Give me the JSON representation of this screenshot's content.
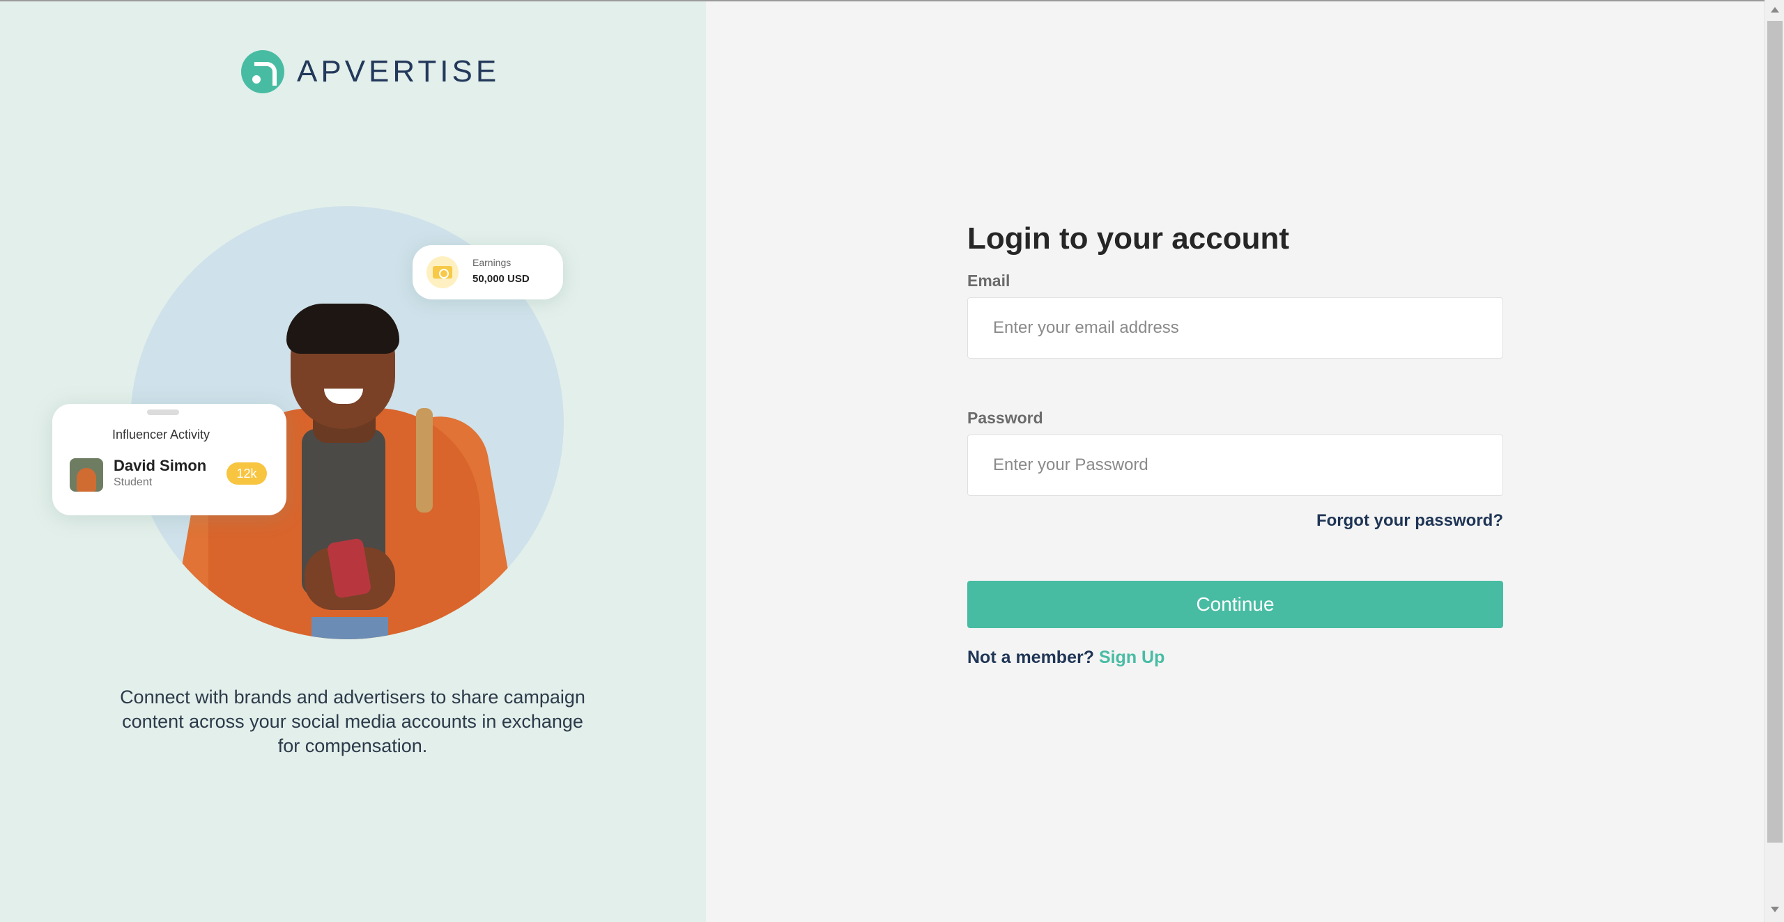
{
  "brand": {
    "name": "APVERTISE",
    "accent": "#48bca3",
    "navy": "#1f3556"
  },
  "hero": {
    "earnings": {
      "label": "Earnings",
      "value": "50,000 USD",
      "icon": "money-icon"
    },
    "influencer": {
      "title": "Influencer Activity",
      "name": "David Simon",
      "role": "Student",
      "badge": "12k"
    },
    "tagline": "Connect with brands and advertisers to share campaign content across your social media accounts in exchange for compensation."
  },
  "login": {
    "title": "Login to your account",
    "email_label": "Email",
    "email_placeholder": "Enter your email address",
    "email_value": "",
    "password_label": "Password",
    "password_placeholder": "Enter your Password",
    "password_value": "",
    "forgot": "Forgot your password?",
    "continue": "Continue",
    "not_member": "Not a member?",
    "signup": "Sign Up"
  }
}
